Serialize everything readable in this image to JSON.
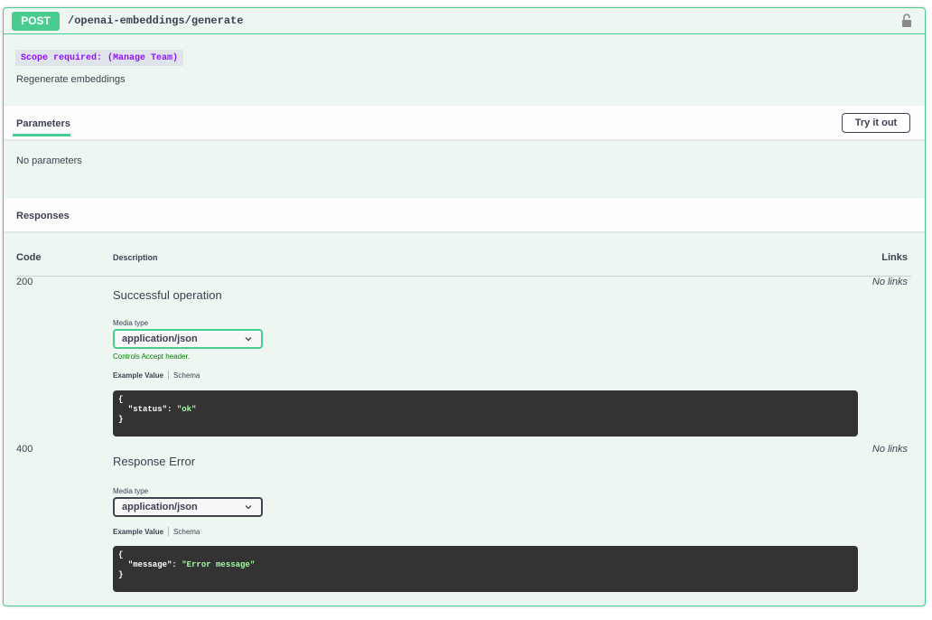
{
  "summary": {
    "method": "POST",
    "path": "/openai-embeddings/generate"
  },
  "scope_label": "Scope required: (Manage Team)",
  "description": "Regenerate embeddings",
  "parameters": {
    "title": "Parameters",
    "try_button": "Try it out",
    "empty": "No parameters"
  },
  "responses": {
    "title": "Responses",
    "columns": {
      "code": "Code",
      "description": "Description",
      "links": "Links"
    },
    "rows": [
      {
        "code": "200",
        "description": "Successful operation",
        "media_label": "Media type",
        "media_value": "application/json",
        "controls_note": "Controls Accept header.",
        "example_tab": "Example Value",
        "schema_tab": "Schema",
        "code_open": "{",
        "code_key": "  \"status\": ",
        "code_value": "\"ok\"",
        "code_close": "}",
        "links": "No links"
      },
      {
        "code": "400",
        "description": "Response Error",
        "media_label": "Media type",
        "media_value": "application/json",
        "example_tab": "Example Value",
        "schema_tab": "Schema",
        "code_open": "{",
        "code_key": "  \"message\": ",
        "code_value": "\"Error message\"",
        "code_close": "}",
        "links": "No links"
      }
    ]
  },
  "icons": {
    "lock": "lock-icon",
    "chevron": "chevron-down-icon"
  },
  "colors": {
    "accent": "#49cc90",
    "background": "#eef6f1",
    "scope": "#9012fe",
    "code_bg": "#333333",
    "string": "#a2fca2"
  }
}
